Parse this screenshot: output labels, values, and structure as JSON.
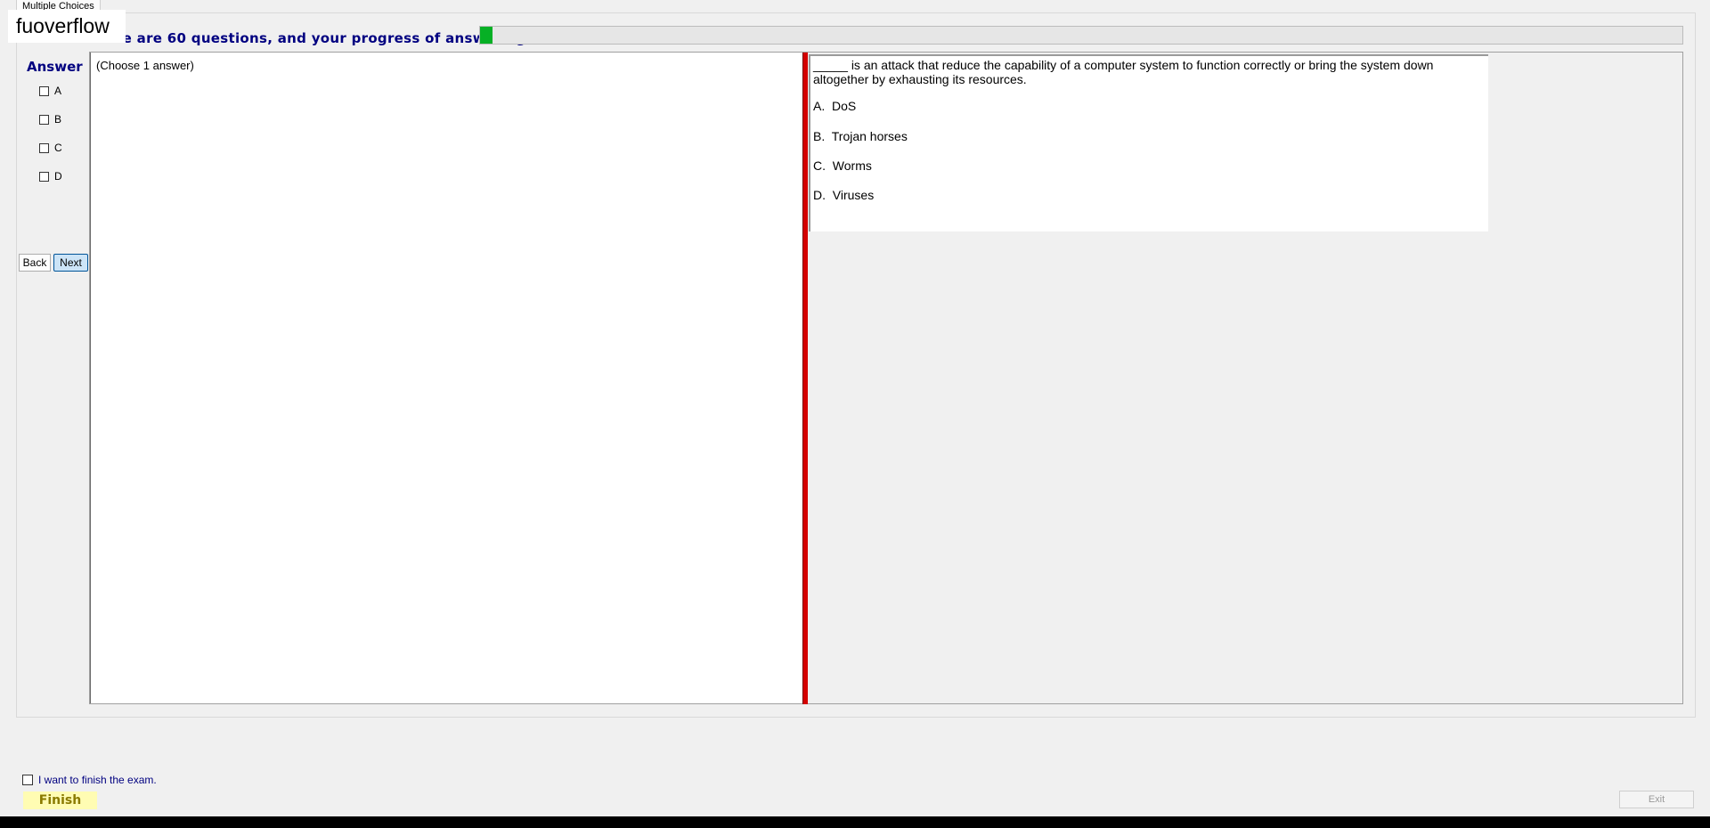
{
  "watermark": "fuoverflow",
  "tab": {
    "label": "Multiple Choices"
  },
  "progress": {
    "text": "There are 60 questions, and your progress of answering is",
    "fraction": 0.01,
    "fill_color": "#06b025"
  },
  "answer": {
    "heading": "Answer",
    "options": [
      {
        "label": "A",
        "checked": false
      },
      {
        "label": "B",
        "checked": false
      },
      {
        "label": "C",
        "checked": false
      },
      {
        "label": "D",
        "checked": false
      }
    ]
  },
  "nav": {
    "back_label": "Back",
    "next_label": "Next"
  },
  "left_pane": {
    "instruction": "(Choose 1 answer)"
  },
  "question": {
    "text": "_____ is an attack that reduce the capability of a computer system to function correctly or bring the system down altogether by exhausting its resources.",
    "choices": [
      "A.  DoS",
      "B.  Trojan horses",
      "C.  Worms",
      "D.  Viruses"
    ]
  },
  "footer": {
    "finish_check_label": "I want to finish the exam.",
    "finish_label": "Finish",
    "exit_label": "Exit"
  },
  "colors": {
    "heading": "#000080",
    "splitter": "#d40000",
    "finish_bg": "#fffcb3"
  }
}
